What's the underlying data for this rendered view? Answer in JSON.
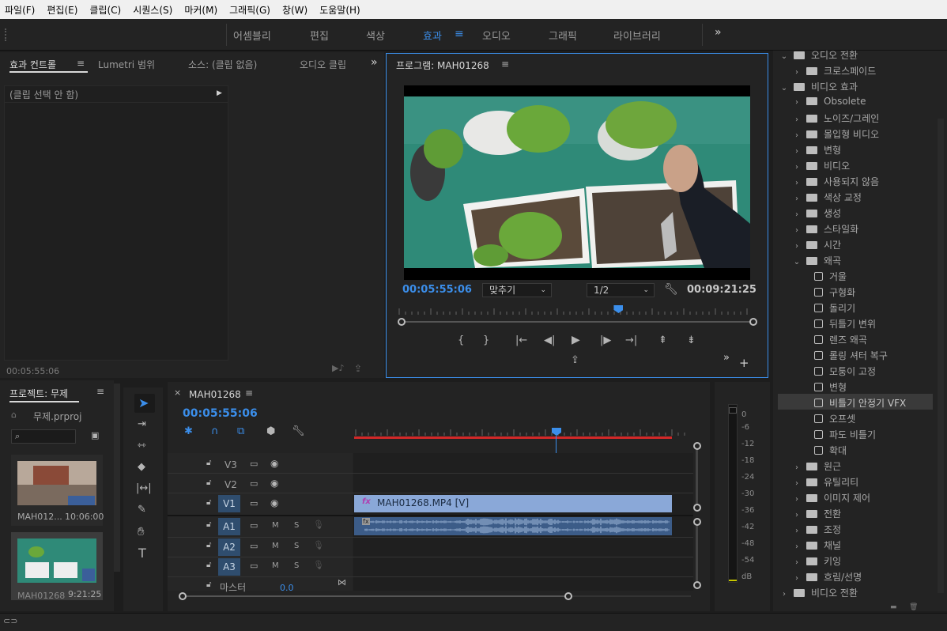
{
  "menu": [
    "파일(F)",
    "편집(E)",
    "클립(C)",
    "시퀀스(S)",
    "마커(M)",
    "그래픽(G)",
    "창(W)",
    "도움말(H)"
  ],
  "workspaces": [
    {
      "label": "어셈블리",
      "active": false
    },
    {
      "label": "편집",
      "active": false
    },
    {
      "label": "색상",
      "active": false
    },
    {
      "label": "효과",
      "active": true
    },
    {
      "label": "오디오",
      "active": false
    },
    {
      "label": "그래픽",
      "active": false
    },
    {
      "label": "라이브러리",
      "active": false
    }
  ],
  "source_panel": {
    "tabs": [
      "효과 컨트롤",
      "Lumetri 범위",
      "소스: (클립 없음)",
      "오디오 클립"
    ],
    "no_clip": "(클립 선택 안 함)",
    "timecode": "00:05:55:06"
  },
  "program": {
    "title": "프로그램: MAH01268",
    "timecode_current": "00:05:55:06",
    "fit": "맞추기",
    "resolution": "1/2",
    "timecode_duration": "00:09:21:25",
    "playhead_fraction": 0.621
  },
  "project": {
    "title": "프로젝트: 무제",
    "file": "무제.prproj",
    "items": [
      {
        "name": "MAH012...",
        "duration": "10:06:00"
      },
      {
        "name": "MAH01268",
        "duration": "9:21:25"
      }
    ]
  },
  "timeline": {
    "sequence": "MAH01268",
    "timecode": "00:05:55:06",
    "video_tracks": [
      "V3",
      "V2",
      "V1"
    ],
    "audio_tracks": [
      "A1",
      "A2",
      "A3"
    ],
    "master_label": "마스터",
    "master_value": "0.0",
    "clip_label": "MAH01268.MP4 [V]",
    "ms": "M",
    "ss": "S"
  },
  "meter": {
    "labels": [
      "0",
      "-6",
      "-12",
      "-18",
      "-24",
      "-30",
      "-36",
      "-42",
      "-48",
      "-54",
      "dB"
    ]
  },
  "effects_tree": [
    {
      "label": "오디오 전환",
      "type": "folder",
      "level": 0,
      "open": true
    },
    {
      "label": "크로스페이드",
      "type": "folder",
      "level": 1,
      "open": false
    },
    {
      "label": "비디오 효과",
      "type": "folder",
      "level": 0,
      "open": true
    },
    {
      "label": "Obsolete",
      "type": "folder",
      "level": 1,
      "open": false
    },
    {
      "label": "노이즈/그레인",
      "type": "folder",
      "level": 1,
      "open": false
    },
    {
      "label": "몰입형 비디오",
      "type": "folder",
      "level": 1,
      "open": false
    },
    {
      "label": "변형",
      "type": "folder",
      "level": 1,
      "open": false
    },
    {
      "label": "비디오",
      "type": "folder",
      "level": 1,
      "open": false
    },
    {
      "label": "사용되지 않음",
      "type": "folder",
      "level": 1,
      "open": false
    },
    {
      "label": "색상 교정",
      "type": "folder",
      "level": 1,
      "open": false
    },
    {
      "label": "생성",
      "type": "folder",
      "level": 1,
      "open": false
    },
    {
      "label": "스타일화",
      "type": "folder",
      "level": 1,
      "open": false
    },
    {
      "label": "시간",
      "type": "folder",
      "level": 1,
      "open": false
    },
    {
      "label": "왜곡",
      "type": "folder",
      "level": 1,
      "open": true
    },
    {
      "label": "거울",
      "type": "preset",
      "level": 2
    },
    {
      "label": "구형화",
      "type": "preset",
      "level": 2
    },
    {
      "label": "돌리기",
      "type": "preset",
      "level": 2
    },
    {
      "label": "뒤틀기 변위",
      "type": "preset",
      "level": 2
    },
    {
      "label": "렌즈 왜곡",
      "type": "preset",
      "level": 2
    },
    {
      "label": "롤링 셔터 복구",
      "type": "preset",
      "level": 2
    },
    {
      "label": "모퉁이 고정",
      "type": "preset",
      "level": 2
    },
    {
      "label": "변형",
      "type": "preset",
      "level": 2
    },
    {
      "label": "비틀기 안정기 VFX",
      "type": "preset",
      "level": 2,
      "selected": true
    },
    {
      "label": "오프셋",
      "type": "preset",
      "level": 2
    },
    {
      "label": "파도 비틀기",
      "type": "preset",
      "level": 2
    },
    {
      "label": "확대",
      "type": "preset",
      "level": 2
    },
    {
      "label": "원근",
      "type": "folder",
      "level": 1,
      "open": false
    },
    {
      "label": "유틸리티",
      "type": "folder",
      "level": 1,
      "open": false
    },
    {
      "label": "이미지 제어",
      "type": "folder",
      "level": 1,
      "open": false
    },
    {
      "label": "전환",
      "type": "folder",
      "level": 1,
      "open": false
    },
    {
      "label": "조정",
      "type": "folder",
      "level": 1,
      "open": false
    },
    {
      "label": "채널",
      "type": "folder",
      "level": 1,
      "open": false
    },
    {
      "label": "키잉",
      "type": "folder",
      "level": 1,
      "open": false
    },
    {
      "label": "흐림/선명",
      "type": "folder",
      "level": 1,
      "open": false
    },
    {
      "label": "비디오 전환",
      "type": "folder",
      "level": 0,
      "open": false
    }
  ],
  "colors": {
    "accent": "#3b8eea",
    "clip_video": "#8aa8d8",
    "clip_audio": "#3c5c88",
    "work_area": "#d22828"
  }
}
